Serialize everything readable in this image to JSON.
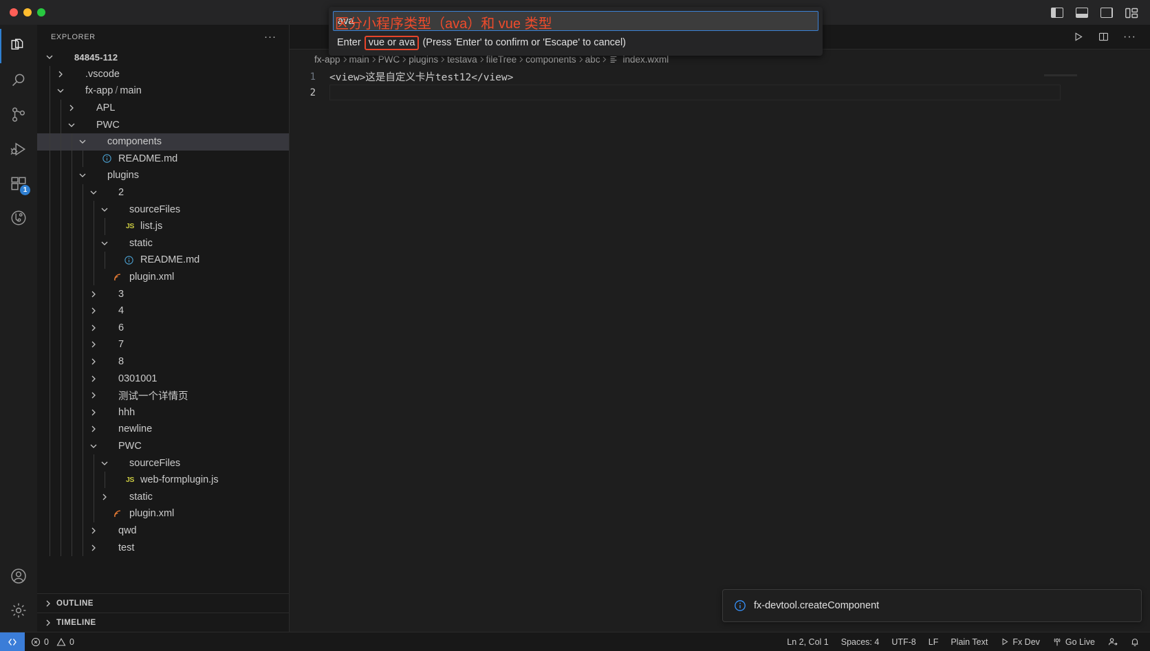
{
  "window": {
    "title_actions": [
      {
        "name": "toggle-primary-sidebar",
        "icon": "layout-sidebar-left-icon"
      },
      {
        "name": "toggle-panel",
        "icon": "layout-panel-icon"
      },
      {
        "name": "toggle-secondary-sidebar",
        "icon": "layout-sidebar-right-icon"
      },
      {
        "name": "customize-layout",
        "icon": "layout-grid-icon"
      }
    ]
  },
  "activitybar": {
    "items": [
      {
        "name": "explorer",
        "icon": "files-icon",
        "active": true,
        "badge": ""
      },
      {
        "name": "search",
        "icon": "search-icon",
        "active": false,
        "badge": ""
      },
      {
        "name": "source-control",
        "icon": "source-control-icon",
        "active": false,
        "badge": ""
      },
      {
        "name": "run-and-debug",
        "icon": "debug-icon",
        "active": false,
        "badge": ""
      },
      {
        "name": "extensions",
        "icon": "extensions-icon",
        "active": false,
        "badge": "1"
      },
      {
        "name": "testing",
        "icon": "beaker-icon",
        "active": false,
        "badge": ""
      }
    ],
    "bottom_items": [
      {
        "name": "accounts",
        "icon": "account-icon"
      },
      {
        "name": "manage-settings",
        "icon": "gear-icon"
      }
    ]
  },
  "sidebar": {
    "header": "EXPLORER",
    "more_actions": "···",
    "tree": [
      {
        "label": "84845-112",
        "depth": 0,
        "expanded": true,
        "type": "root",
        "icon": "none",
        "selected": false
      },
      {
        "label": ".vscode",
        "depth": 1,
        "expanded": false,
        "type": "folder",
        "icon": "none",
        "selected": false
      },
      {
        "label": "fx-app",
        "label2": "main",
        "depth": 1,
        "expanded": true,
        "type": "folder",
        "icon": "none",
        "selected": false
      },
      {
        "label": "APL",
        "depth": 2,
        "expanded": false,
        "type": "folder",
        "icon": "none",
        "selected": false
      },
      {
        "label": "PWC",
        "depth": 2,
        "expanded": true,
        "type": "folder",
        "icon": "none",
        "selected": false
      },
      {
        "label": "components",
        "depth": 3,
        "expanded": true,
        "type": "folder",
        "icon": "none",
        "selected": true
      },
      {
        "label": "README.md",
        "depth": 4,
        "expanded": null,
        "type": "file",
        "icon": "md",
        "selected": false
      },
      {
        "label": "plugins",
        "depth": 3,
        "expanded": true,
        "type": "folder",
        "icon": "none",
        "selected": false
      },
      {
        "label": "2",
        "depth": 4,
        "expanded": true,
        "type": "folder",
        "icon": "none",
        "selected": false
      },
      {
        "label": "sourceFiles",
        "depth": 5,
        "expanded": true,
        "type": "folder",
        "icon": "none",
        "selected": false
      },
      {
        "label": "list.js",
        "depth": 6,
        "expanded": null,
        "type": "file",
        "icon": "js",
        "selected": false
      },
      {
        "label": "static",
        "depth": 5,
        "expanded": true,
        "type": "folder",
        "icon": "none",
        "selected": false
      },
      {
        "label": "README.md",
        "depth": 6,
        "expanded": null,
        "type": "file",
        "icon": "md",
        "selected": false
      },
      {
        "label": "plugin.xml",
        "depth": 5,
        "expanded": null,
        "type": "file",
        "icon": "xml",
        "selected": false
      },
      {
        "label": "3",
        "depth": 4,
        "expanded": false,
        "type": "folder",
        "icon": "none",
        "selected": false
      },
      {
        "label": "4",
        "depth": 4,
        "expanded": false,
        "type": "folder",
        "icon": "none",
        "selected": false
      },
      {
        "label": "6",
        "depth": 4,
        "expanded": false,
        "type": "folder",
        "icon": "none",
        "selected": false
      },
      {
        "label": "7",
        "depth": 4,
        "expanded": false,
        "type": "folder",
        "icon": "none",
        "selected": false
      },
      {
        "label": "8",
        "depth": 4,
        "expanded": false,
        "type": "folder",
        "icon": "none",
        "selected": false
      },
      {
        "label": "0301001",
        "depth": 4,
        "expanded": false,
        "type": "folder",
        "icon": "none",
        "selected": false
      },
      {
        "label": "测试一个详情页",
        "depth": 4,
        "expanded": false,
        "type": "folder",
        "icon": "none",
        "selected": false
      },
      {
        "label": "hhh",
        "depth": 4,
        "expanded": false,
        "type": "folder",
        "icon": "none",
        "selected": false
      },
      {
        "label": "newline",
        "depth": 4,
        "expanded": false,
        "type": "folder",
        "icon": "none",
        "selected": false
      },
      {
        "label": "PWC",
        "depth": 4,
        "expanded": true,
        "type": "folder",
        "icon": "none",
        "selected": false
      },
      {
        "label": "sourceFiles",
        "depth": 5,
        "expanded": true,
        "type": "folder",
        "icon": "none",
        "selected": false
      },
      {
        "label": "web-formplugin.js",
        "depth": 6,
        "expanded": null,
        "type": "file",
        "icon": "js",
        "selected": false
      },
      {
        "label": "static",
        "depth": 5,
        "expanded": false,
        "type": "folder",
        "icon": "none",
        "selected": false
      },
      {
        "label": "plugin.xml",
        "depth": 5,
        "expanded": null,
        "type": "file",
        "icon": "xml",
        "selected": false
      },
      {
        "label": "qwd",
        "depth": 4,
        "expanded": false,
        "type": "folder",
        "icon": "none",
        "selected": false
      },
      {
        "label": "test",
        "depth": 4,
        "expanded": false,
        "type": "folder",
        "icon": "none",
        "selected": false
      }
    ],
    "sections": [
      {
        "label": "OUTLINE",
        "expanded": false
      },
      {
        "label": "TIMELINE",
        "expanded": false
      }
    ]
  },
  "editor": {
    "toolbar": [
      {
        "name": "run-code",
        "icon": "play-icon"
      },
      {
        "name": "split-editor-right",
        "icon": "split-editor-icon"
      },
      {
        "name": "more-actions",
        "icon": "ellipsis-icon"
      }
    ],
    "breadcrumbs": [
      "fx-app",
      "main",
      "PWC",
      "plugins",
      "testava",
      "fileTree",
      "components",
      "abc"
    ],
    "breadcrumb_file": "index.wxml",
    "lines": [
      {
        "num": "1",
        "text": "<view>这是自定义卡片test12</view>"
      },
      {
        "num": "2",
        "text": ""
      }
    ]
  },
  "quick_input": {
    "value": "ava",
    "message_prefix": "Enter",
    "message_highlight": "vue or ava",
    "message_suffix": "(Press 'Enter' to confirm or 'Escape' to cancel)",
    "annotation": "区分小程序类型（ava）和 vue 类型",
    "annotation_color": "#ef4b2b",
    "highlight_color": "#e8442a"
  },
  "notification": {
    "icon": "info-icon",
    "text": "fx-devtool.createComponent"
  },
  "statusbar": {
    "remote_icon": "remote-window-icon",
    "problems": {
      "errors": "0",
      "warnings": "0"
    },
    "right_items": [
      {
        "name": "editor-position",
        "label": "Ln 2, Col 1",
        "icon": ""
      },
      {
        "name": "editor-indentation",
        "label": "Spaces: 4",
        "icon": ""
      },
      {
        "name": "editor-encoding",
        "label": "UTF-8",
        "icon": ""
      },
      {
        "name": "editor-eol",
        "label": "LF",
        "icon": ""
      },
      {
        "name": "editor-language",
        "label": "Plain Text",
        "icon": ""
      },
      {
        "name": "fx-dev",
        "label": "Fx Dev",
        "icon": "play-icon"
      },
      {
        "name": "go-live",
        "label": "Go Live",
        "icon": "broadcast-icon"
      },
      {
        "name": "live-share",
        "label": "",
        "icon": "live-share-icon"
      },
      {
        "name": "notifications",
        "label": "",
        "icon": "bell-icon"
      }
    ]
  },
  "colors": {
    "accent": "#2f7fd1",
    "background": "#1e1e1e",
    "sidebar_bg": "#181818",
    "selection": "#37373d"
  }
}
